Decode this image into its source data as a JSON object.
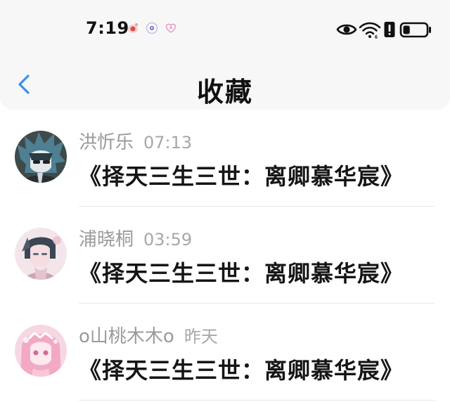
{
  "status_bar": {
    "time": "7:19",
    "notification_icons": [
      "weibo-icon",
      "app-icon",
      "heart-app-icon"
    ],
    "right_icons": [
      "eye-icon",
      "wifi-icon",
      "alert-icon",
      "battery-icon"
    ],
    "battery_level": 0.3
  },
  "header": {
    "back_icon": "chevron-left-icon",
    "title": "收藏"
  },
  "favorites": [
    {
      "name": "洪忻乐",
      "time": "07:13",
      "content": "《择天三生三世：离卿慕华宸》"
    },
    {
      "name": "浦晓桐",
      "time": "03:59",
      "content": "《择天三生三世：离卿慕华宸》"
    },
    {
      "name": "o山桃木木o",
      "time": "昨天",
      "content": "《择天三生三世：离卿慕华宸》"
    }
  ],
  "colors": {
    "accent": "#3d8ee6",
    "header_bg": "#f7f7f7",
    "meta_text": "#9a9a9a",
    "content_text": "#151515"
  }
}
